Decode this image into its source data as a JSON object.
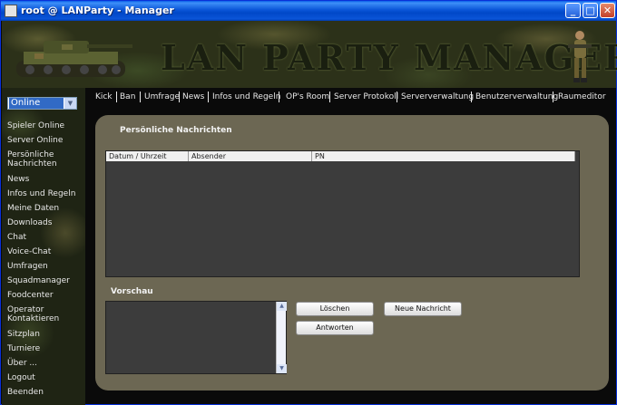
{
  "window": {
    "title": "root @ LANParty - Manager",
    "minimize": "_",
    "maximize": "□",
    "close": "✕"
  },
  "banner": {
    "title": "LAN PARTY MANAGER"
  },
  "status_select": {
    "value": "Online",
    "arrow": "▼"
  },
  "sidebar": {
    "items": [
      "Spieler Online",
      "Server Online",
      "Persönliche",
      "Nachrichten",
      "News",
      "Infos und Regeln",
      "Meine Daten",
      "Downloads",
      "Chat",
      "Voice-Chat",
      "Umfragen",
      "Squadmanager",
      "Foodcenter",
      "Operator",
      "Kontaktieren",
      "Sitzplan",
      "Turniere",
      "Über ...",
      "Logout",
      "Beenden"
    ]
  },
  "nav": {
    "items": [
      "Kick",
      "Ban",
      "Umfrage",
      "News",
      "Infos und Regeln",
      "OP's Room",
      "Server Protokoll",
      "Serververwaltung",
      "Benutzerverwaltung",
      "Raumeditor"
    ]
  },
  "main": {
    "section_title": "Persönliche Nachrichten",
    "columns": [
      "Datum / Uhrzeit",
      "Absender",
      "PN"
    ],
    "preview_title": "Vorschau",
    "buttons": {
      "delete": "Löschen",
      "new_message": "Neue Nachricht",
      "reply": "Antworten"
    },
    "scroll_up": "▲",
    "scroll_down": "▼"
  },
  "colors": {
    "panel": "#6c6753",
    "list_bg": "#3c3c3c",
    "titlebar": "#0a55d8"
  }
}
